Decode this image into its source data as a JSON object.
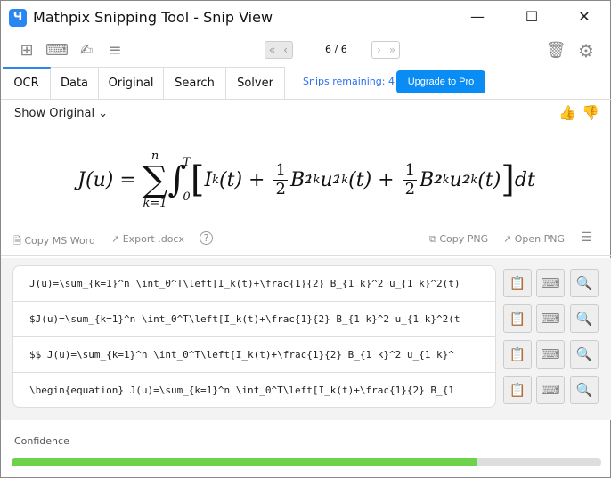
{
  "window": {
    "title": "Mathpix Snipping Tool - Snip View",
    "logo": "Ч"
  },
  "toolbar": {
    "pager": "6 / 6",
    "icons": [
      "new-snip-icon",
      "keyboard-icon",
      "handwriting-icon",
      "list-icon",
      "trash-icon",
      "gear-icon"
    ]
  },
  "tabs": [
    {
      "label": "OCR"
    },
    {
      "label": "Data"
    },
    {
      "label": "Original"
    },
    {
      "label": "Search"
    },
    {
      "label": "Solver"
    }
  ],
  "snips_remaining": "Snips remaining: 4",
  "upgrade_label": "Upgrade to Pro",
  "show_original": "Show Original",
  "equation": {
    "lhs": "J(u) =",
    "sum_top": "n",
    "sum_bot": "k=1",
    "int_top": "T",
    "int_bot": "0",
    "one": "1",
    "two": "2"
  },
  "actions": {
    "copy_word": "Copy MS Word",
    "export_docx": "Export .docx",
    "help": "?",
    "copy_png": "Copy PNG",
    "open_png": "Open PNG"
  },
  "results": [
    "J(u)=\\sum_{k=1}^n \\int_0^T\\left[I_k(t)+\\frac{1}{2} B_{1 k}^2 u_{1 k}^2(t)",
    "$J(u)=\\sum_{k=1}^n \\int_0^T\\left[I_k(t)+\\frac{1}{2} B_{1 k}^2 u_{1 k}^2(t",
    "$$  J(u)=\\sum_{k=1}^n \\int_0^T\\left[I_k(t)+\\frac{1}{2} B_{1 k}^2 u_{1 k}^",
    "\\begin{equation}  J(u)=\\sum_{k=1}^n \\int_0^T\\left[I_k(t)+\\frac{1}{2} B_{1"
  ],
  "confidence": {
    "label": "Confidence",
    "value_percent": 79
  },
  "colors": {
    "accent": "#0a8cf5",
    "confidence": "#6ed34a"
  }
}
